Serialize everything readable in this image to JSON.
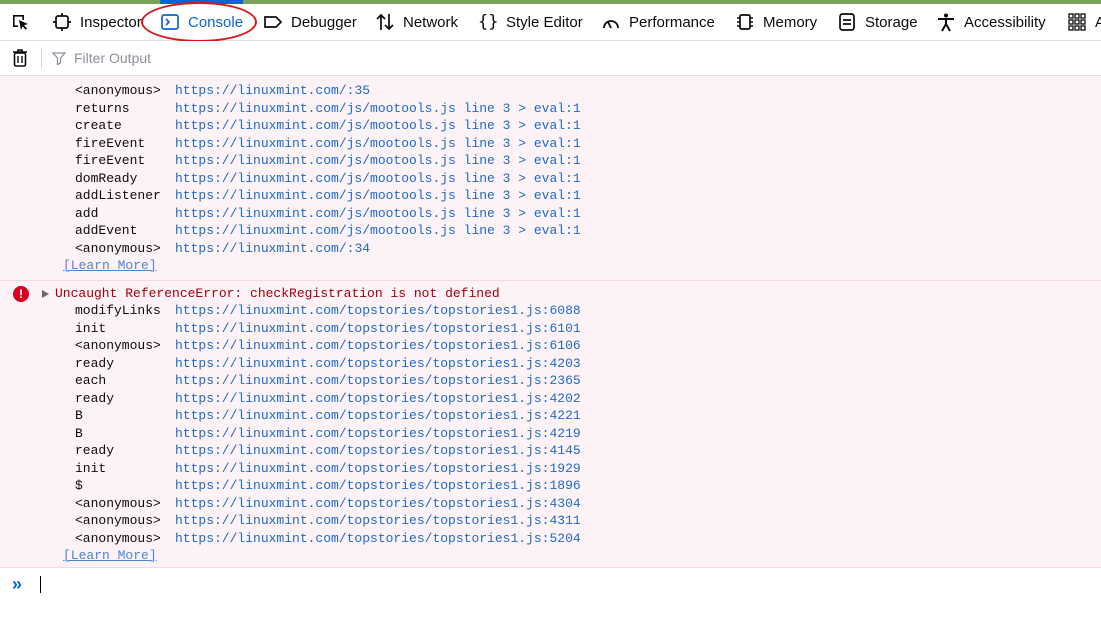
{
  "tabs": [
    {
      "label": "Inspector",
      "icon": "inspector-icon"
    },
    {
      "label": "Console",
      "icon": "console-icon",
      "selected": true
    },
    {
      "label": "Debugger",
      "icon": "debugger-icon"
    },
    {
      "label": "Network",
      "icon": "network-icon"
    },
    {
      "label": "Style Editor",
      "icon": "style-editor-icon"
    },
    {
      "label": "Performance",
      "icon": "performance-icon"
    },
    {
      "label": "Memory",
      "icon": "memory-icon"
    },
    {
      "label": "Storage",
      "icon": "storage-icon"
    },
    {
      "label": "Accessibility",
      "icon": "accessibility-icon"
    },
    {
      "label": "A",
      "icon": "application-icon"
    }
  ],
  "toolbar": {
    "filter_placeholder": "Filter Output"
  },
  "colors": {
    "accent": "#0a64d6",
    "error_text": "#a4000f",
    "error_bg": "#fdf2f5",
    "link": "#1e6ac7",
    "highlight_circle": "#d7191c"
  },
  "messages": [
    {
      "type": "error-stack-continued",
      "frames": [
        {
          "fn": "<anonymous>",
          "url": "https://linuxmint.com/",
          "line": "35"
        },
        {
          "fn": "returns",
          "url": "https://linuxmint.com/js/mootools.js line 3 > eval",
          "line": "1"
        },
        {
          "fn": "create",
          "url": "https://linuxmint.com/js/mootools.js line 3 > eval",
          "line": "1"
        },
        {
          "fn": "fireEvent",
          "url": "https://linuxmint.com/js/mootools.js line 3 > eval",
          "line": "1"
        },
        {
          "fn": "fireEvent",
          "url": "https://linuxmint.com/js/mootools.js line 3 > eval",
          "line": "1"
        },
        {
          "fn": "domReady",
          "url": "https://linuxmint.com/js/mootools.js line 3 > eval",
          "line": "1"
        },
        {
          "fn": "addListener",
          "url": "https://linuxmint.com/js/mootools.js line 3 > eval",
          "line": "1"
        },
        {
          "fn": "add",
          "url": "https://linuxmint.com/js/mootools.js line 3 > eval",
          "line": "1"
        },
        {
          "fn": "addEvent",
          "url": "https://linuxmint.com/js/mootools.js line 3 > eval",
          "line": "1"
        },
        {
          "fn": "<anonymous>",
          "url": "https://linuxmint.com/",
          "line": "34"
        }
      ],
      "learn_more": "[Learn More]"
    },
    {
      "type": "error",
      "text": "Uncaught ReferenceError: checkRegistration is not defined",
      "frames": [
        {
          "fn": "modifyLinks",
          "url": "https://linuxmint.com/topstories/topstories1.js",
          "line": "6088"
        },
        {
          "fn": "init",
          "url": "https://linuxmint.com/topstories/topstories1.js",
          "line": "6101"
        },
        {
          "fn": "<anonymous>",
          "url": "https://linuxmint.com/topstories/topstories1.js",
          "line": "6106"
        },
        {
          "fn": "ready",
          "url": "https://linuxmint.com/topstories/topstories1.js",
          "line": "4203"
        },
        {
          "fn": "each",
          "url": "https://linuxmint.com/topstories/topstories1.js",
          "line": "2365"
        },
        {
          "fn": "ready",
          "url": "https://linuxmint.com/topstories/topstories1.js",
          "line": "4202"
        },
        {
          "fn": "B",
          "url": "https://linuxmint.com/topstories/topstories1.js",
          "line": "4221"
        },
        {
          "fn": "B",
          "url": "https://linuxmint.com/topstories/topstories1.js",
          "line": "4219"
        },
        {
          "fn": "ready",
          "url": "https://linuxmint.com/topstories/topstories1.js",
          "line": "4145"
        },
        {
          "fn": "init",
          "url": "https://linuxmint.com/topstories/topstories1.js",
          "line": "1929"
        },
        {
          "fn": "$",
          "url": "https://linuxmint.com/topstories/topstories1.js",
          "line": "1896"
        },
        {
          "fn": "<anonymous>",
          "url": "https://linuxmint.com/topstories/topstories1.js",
          "line": "4304"
        },
        {
          "fn": "<anonymous>",
          "url": "https://linuxmint.com/topstories/topstories1.js",
          "line": "4311"
        },
        {
          "fn": "<anonymous>",
          "url": "https://linuxmint.com/topstories/topstories1.js",
          "line": "5204"
        }
      ],
      "learn_more": "[Learn More]"
    }
  ]
}
